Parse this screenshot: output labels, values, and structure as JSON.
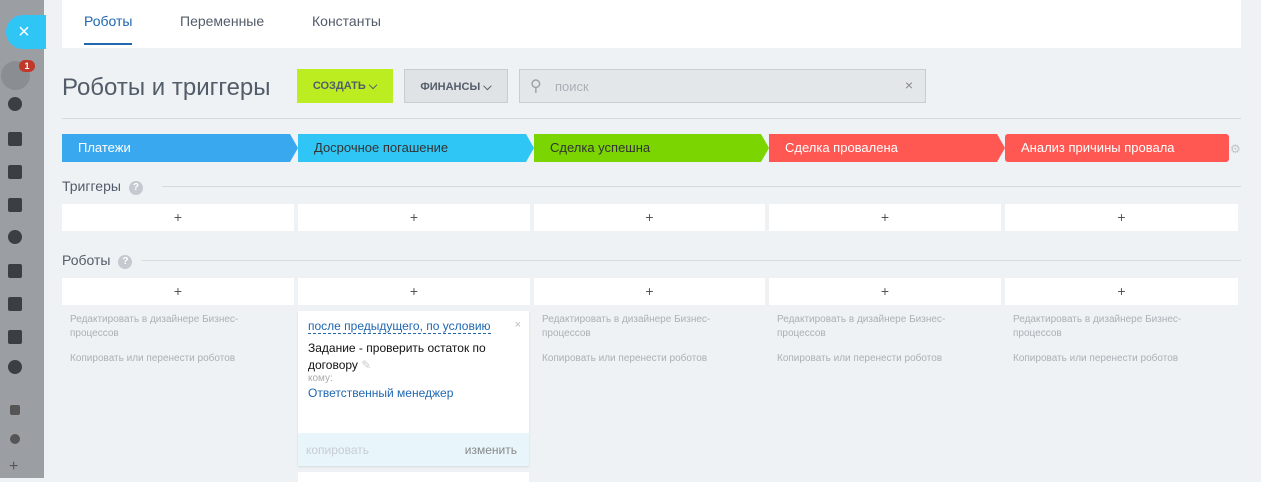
{
  "sidebar": {
    "close_icon": "×",
    "badge": "1",
    "icons": [
      "filter-icon",
      "target-icon",
      "window-icon",
      "cart-icon",
      "task-icon",
      "sites-icon",
      "contact-icon",
      "sync-icon",
      "box-icon",
      "more-icon",
      "structure-icon",
      "gear-icon",
      "plus-icon"
    ]
  },
  "tabs": [
    {
      "label": "Роботы"
    },
    {
      "label": "Переменные"
    },
    {
      "label": "Константы"
    }
  ],
  "title": "Роботы и триггеры",
  "toolbar": {
    "create": "СОЗДАТЬ ⌵",
    "finance": "ФИНАНСЫ ⌵",
    "search_placeholder": "поиск",
    "clear": "×"
  },
  "stages": [
    {
      "label": "Платежи",
      "color": "#39a8ef"
    },
    {
      "label": "Досрочное погашение",
      "color": "#2fc6f6"
    },
    {
      "label": "Сделка успешна",
      "color": "#7bd500"
    },
    {
      "label": "Сделка провалена",
      "color": "#ff5752"
    },
    {
      "label": "Анализ причины провала",
      "color": "#ff5752"
    }
  ],
  "triggers": {
    "label": "Триггеры",
    "help": "?"
  },
  "robots": {
    "label": "Роботы",
    "help": "?"
  },
  "plus": "+",
  "links": {
    "designer": "Редактировать в дизайнере Бизнес-процессов",
    "copy": "Копировать или перенести роботов"
  },
  "card": {
    "condition": "после предыдущего, по условию",
    "close": "×",
    "name": "Задание - проверить остаток по договору",
    "to_label": "кому:",
    "responsible": "Ответственный менеджер",
    "copy": "копировать",
    "edit": "изменить"
  }
}
